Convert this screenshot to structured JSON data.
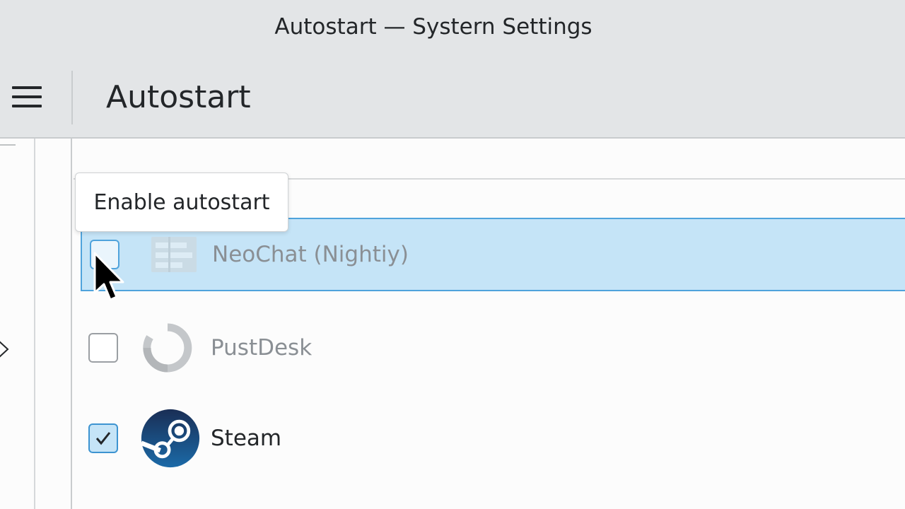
{
  "window": {
    "title": "Autostart — Systern Settings"
  },
  "header": {
    "page_title": "Autostart",
    "menu_icon": "hamburger-menu-icon"
  },
  "tooltip": {
    "text": "Enable autostart"
  },
  "autostart_list": {
    "items": [
      {
        "name": "NeoChat (Nightiy)",
        "enabled": false,
        "selected": true,
        "icon": "neochat-icon"
      },
      {
        "name": "PustDesk",
        "enabled": false,
        "selected": false,
        "icon": "rustdesk-icon"
      },
      {
        "name": "Steam",
        "enabled": true,
        "selected": false,
        "icon": "steam-icon"
      }
    ]
  },
  "colors": {
    "titlebar_bg": "#e3e5e7",
    "selection_bg": "#c5e4f7",
    "selection_border": "#4fa3dc",
    "accent": "#3d94d1",
    "steam_blue": "#1b4f86"
  }
}
